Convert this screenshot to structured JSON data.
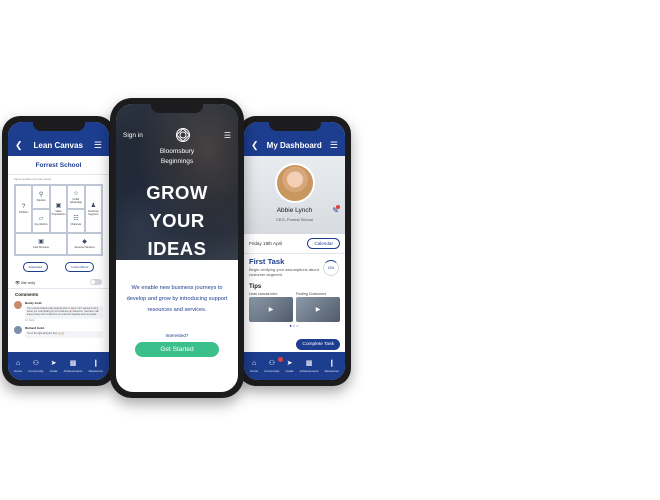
{
  "colors": {
    "primary": "#1d3d8f",
    "accent": "#3cc08b",
    "notification": "#e04040"
  },
  "left_phone": {
    "header": {
      "back_icon": "chevron-left-icon",
      "title": "Lean Canvas",
      "menu_icon": "hamburger-menu-icon"
    },
    "org_name": "Forrest School",
    "hint": "Tap to complete your lean canvas",
    "canvas": {
      "problem": "Problem",
      "solution": "Solution",
      "uvp": "Value Propositions",
      "advantage": "Unfair Advantage",
      "segments": "Customer Segment",
      "kpi": "Key Metrics",
      "channels": "Channels",
      "cost": "Cost Structure",
      "revenue": "Revenue Streams"
    },
    "buttons": {
      "download": "Download",
      "invite": "Invite Others"
    },
    "visibility_label": "Me only",
    "comments_title": "Comments",
    "comments": [
      {
        "name": "Becky Gold",
        "text": "Your canvas looked really amazing when I saw it, but I wanted to tell a better you could finally get your business 🎉 Awesome. I feel like it still leaves many other customers you could be targeting such as people...",
        "meta": "2m   Reply"
      },
      {
        "name": "Richard Gold",
        "text": "I'm on the right along the lines 👍 💬",
        "meta": ""
      }
    ],
    "tabs": [
      {
        "icon": "home-icon",
        "label": "Home"
      },
      {
        "icon": "community-icon",
        "label": "Community"
      },
      {
        "icon": "send-icon",
        "label": "Goals"
      },
      {
        "icon": "chart-icon",
        "label": "Achievements"
      },
      {
        "icon": "resources-icon",
        "label": "Resources"
      }
    ]
  },
  "middle_phone": {
    "signin": "Sign in",
    "brand_line1": "Bloomsbury",
    "brand_line2": "Beginnings",
    "headline": [
      "GROW",
      "YOUR",
      "IDEAS"
    ],
    "body": "We enable new business journeys to develop and grow by introducing support resources and services.",
    "interested": "Interested?",
    "cta": "Get Started"
  },
  "right_phone": {
    "header": {
      "back_icon": "chevron-left-icon",
      "title": "My Dashboard",
      "menu_icon": "hamburger-menu-icon"
    },
    "profile": {
      "name": "Abbie Lynch",
      "role": "CEO, Forrest School"
    },
    "date": "Friday 19th April",
    "calendar_button": "Calendar",
    "task": {
      "title": "First Task",
      "description": "Begin verifying your assumptions about customer segment.",
      "progress": "15%"
    },
    "tips_title": "Tips",
    "tips": [
      {
        "label": "Lean canvas intro"
      },
      {
        "label": "Finding Customers"
      }
    ],
    "complete_button": "Complete Task",
    "tabs": [
      {
        "icon": "home-icon",
        "label": "Home"
      },
      {
        "icon": "community-icon",
        "label": "Community",
        "badge": "1"
      },
      {
        "icon": "send-icon",
        "label": "Goals"
      },
      {
        "icon": "chart-icon",
        "label": "Achievements"
      },
      {
        "icon": "resources-icon",
        "label": "Resources"
      }
    ]
  }
}
